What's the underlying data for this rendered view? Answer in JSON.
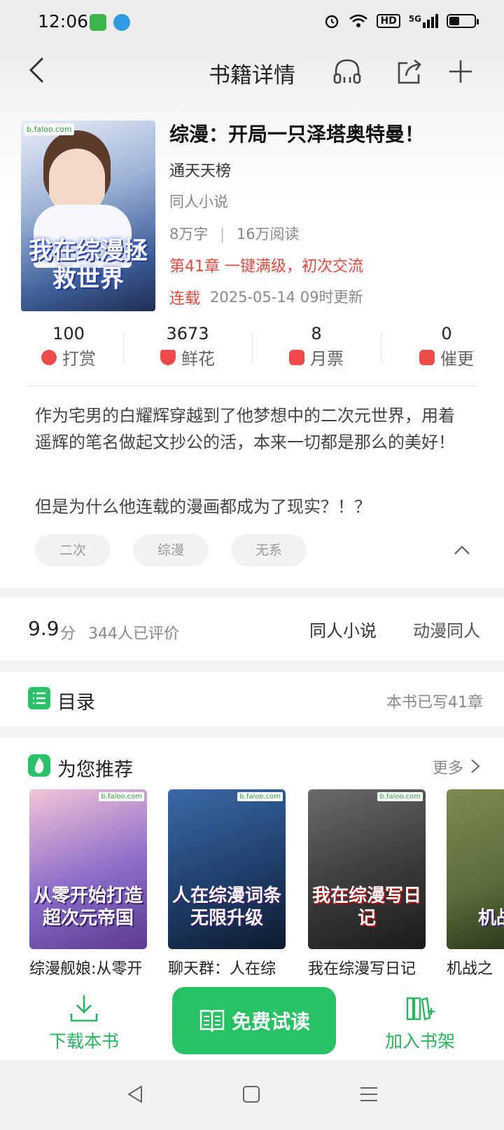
{
  "status_bar": {
    "time": "12:06",
    "icons": [
      "alarm-icon",
      "wifi-icon",
      "hd-icon",
      "5g-signal-icon",
      "battery-icon"
    ],
    "hd": "HD",
    "network": "5G"
  },
  "header": {
    "title": "书籍详情",
    "icons": [
      "back-icon",
      "headphones-icon",
      "share-icon",
      "add-icon"
    ]
  },
  "book": {
    "title": "综漫：开局一只泽塔奥特曼！",
    "author": "通天天榜",
    "category": "同人小说",
    "word_count": "8万字",
    "reads": "16万阅读",
    "latest_chapter": "第41章 一键满级，初次交流",
    "status": "连载",
    "updated": "2025-05-14 09时更新",
    "cover_title": "我在综漫拯救世界",
    "cover_logo": "b.faloo.com"
  },
  "stats": [
    {
      "value": "100",
      "label": "打赏"
    },
    {
      "value": "3673",
      "label": "鲜花"
    },
    {
      "value": "8",
      "label": "月票"
    },
    {
      "value": "0",
      "label": "催更"
    }
  ],
  "description": {
    "para1": "作为宅男的白耀辉穿越到了他梦想中的二次元世界，用着遥辉的笔名做起文抄公的活，本来一切都是那么的美好！",
    "para2": "但是为什么他连载的漫画都成为了现实？！？"
  },
  "tags": [
    "二次",
    "综漫",
    "无系"
  ],
  "rating": {
    "score": "9.9",
    "unit": "分",
    "count": "344人已评价",
    "category1": "同人小说",
    "category2": "动漫同人"
  },
  "toc": {
    "label": "目录",
    "count": "本书已写41章"
  },
  "recommend": {
    "label": "为您推荐",
    "more": "更多",
    "books": [
      {
        "name": "综漫舰娘:从零开",
        "cover_text": "从零开始打造超次元帝国",
        "color_a": "#f3c4d6",
        "color_b": "#5a3b8f"
      },
      {
        "name": "聊天群：人在综",
        "cover_text": "人在综漫词条无限升级",
        "color_a": "#1f3f6b",
        "color_b": "#0e1a2e"
      },
      {
        "name": "我在综漫写日记",
        "cover_text": "我在综漫写日记",
        "color_a": "#4a4a4a",
        "color_b": "#1b1b1b"
      },
      {
        "name": "机战之",
        "cover_text": "机战铁",
        "color_a": "#5b6b3a",
        "color_b": "#1f2a14"
      }
    ]
  },
  "bottom": {
    "download": "下载本书",
    "read": "免费试读",
    "shelf": "加入书架"
  },
  "colors": {
    "accent_green": "#28c265",
    "highlight_red": "#e34a3f"
  }
}
